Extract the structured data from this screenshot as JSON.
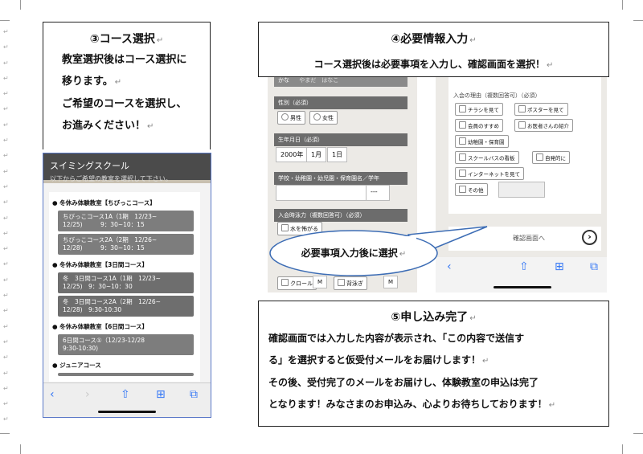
{
  "margin_marks": [
    "↵",
    "↵",
    "↵",
    "↵",
    "↵",
    "↵",
    "↵",
    "↵",
    "↵",
    "↵",
    "↵",
    "↵",
    "↵",
    "↵",
    "↵",
    "↵",
    "↵",
    "↵",
    "↵",
    "↵",
    "↵",
    "↵",
    "↵",
    "↵",
    "↵",
    "↵"
  ],
  "step3": {
    "title": "③コース選択",
    "lines": [
      "教室選択後はコース選択に",
      "移ります。",
      "ご希望のコースを選択し、",
      "お進みください！"
    ],
    "para_mark": "↵"
  },
  "phone1": {
    "header_title": "スイミングスクール",
    "header_subtitle": "以下からご希望の教室を選択して下さい。",
    "sections": [
      {
        "title": "● 冬休み体験教室【ちびっこコース】",
        "courses": [
          "ちびっこコース1A（1期　12/23~\n12/25)　　　9：30~10：15",
          "ちびっこコース2A（2期　12/26~\n12/28)　　　9：30~10：15"
        ]
      },
      {
        "title": "● 冬休み体験教室【3日間コース】",
        "courses": [
          "冬　3日間コース1A（1期　12/23~\n12/25)　9：30~10：30",
          "冬　3日間コース2A（2期　12/26~\n12/28)　9:30-10:30"
        ]
      },
      {
        "title": "● 冬休み体験教室【6日間コース】",
        "courses": [
          "6日間コース①（12/23-12/28\n9:30-10:30)"
        ]
      },
      {
        "title": "● ジュニアコース",
        "courses": []
      }
    ],
    "tabbar": {
      "back": "‹",
      "forward": "›",
      "share": "⇧",
      "bookmarks": "⊞",
      "tabs": "⧉"
    }
  },
  "step4": {
    "title": "④必要情報入力",
    "subtitle": "コース選択後は必要事項を入力し、確認画面を選択！"
  },
  "phone2": {
    "kana_label": "かな",
    "kana_placeholder": "やまだ　はなこ",
    "gender_label": "性別（必須）",
    "gender_options": [
      "男性",
      "女性"
    ],
    "birth_label": "生年月日（必須）",
    "birth_year": "2000年",
    "birth_month": "1月",
    "birth_day": "1日",
    "school_label": "学校・幼稚園・幼児園・保育園名／学年",
    "grade_select": "---",
    "swim_label": "入会時泳力（複数回答可）（必須）",
    "swim_options": [
      "水を怖がる"
    ],
    "bottom_options": [
      "クロール",
      "M",
      "背泳ぎ",
      "M"
    ]
  },
  "phone3": {
    "reason_label": "入会の理由（複数回答可）（必須）",
    "reasons": [
      "チラシを見て",
      "ポスターを見て",
      "会員のすすめ",
      "お医者さんの紹介",
      "幼稚園・保育園",
      "スクールバスの看板",
      "自発的に",
      "インターネットを見て",
      "その他"
    ],
    "confirm_button": "確認画面へ",
    "tabbar": {
      "back": "‹",
      "share": "⇧",
      "bookmarks": "⊞",
      "tabs": "⧉"
    }
  },
  "callout": {
    "text": "必要事項入力後に選択"
  },
  "step5": {
    "title": "⑤申し込み完了",
    "lines": [
      "確認画面では入力した内容が表示され、「この内容で送信す",
      "る」を選択すると仮受付メールをお届けします！",
      "その後、受付完了のメールをお届けし、体験教室の申込は完了",
      "となります！みなさまのお申込み、心よりお待ちしております！"
    ]
  },
  "colors": {
    "header_gray": "#4b4b4b",
    "course_gray": "#7d7d7d",
    "ios_blue": "#3477f5"
  }
}
